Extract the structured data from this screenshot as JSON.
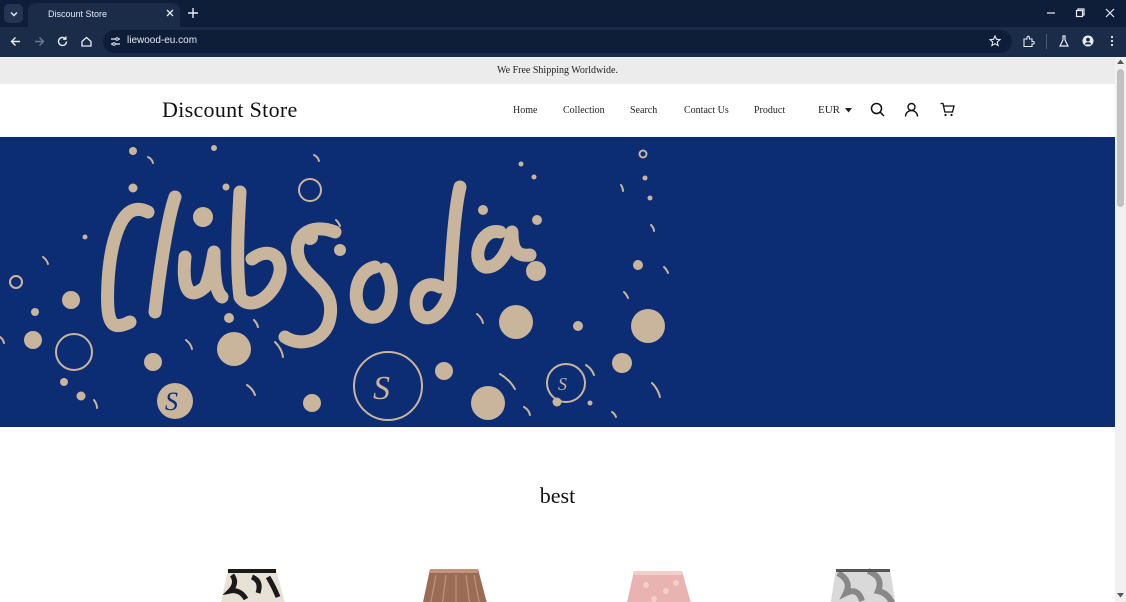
{
  "browser": {
    "tab_title": "Discount Store",
    "url": "liewood-eu.com",
    "icons": [
      "tab-search-icon",
      "close-icon",
      "plus-icon",
      "minimize-icon",
      "restore-icon",
      "close-window-icon",
      "back-icon",
      "forward-icon",
      "reload-icon",
      "home-icon",
      "site-info-icon",
      "star-icon",
      "extensions-icon",
      "labs-icon",
      "profile-icon",
      "more-icon"
    ]
  },
  "announcement": "We Free Shipping Worldwide.",
  "header": {
    "logo": "Discount Store",
    "nav": [
      "Home",
      "Collection",
      "Search",
      "Contact Us",
      "Product"
    ],
    "currency": "EUR",
    "icons": [
      "search-icon",
      "account-icon",
      "cart-icon"
    ]
  },
  "hero": {
    "alt_text_visible": "Club Soda",
    "background": "#0c2d73",
    "art_color": "#c9b49c"
  },
  "section": {
    "title": "best"
  },
  "products": [
    {
      "colors": [
        "#1a1a1a",
        "#e8e2d6"
      ]
    },
    {
      "colors": [
        "#9a6b55",
        "#c2927a"
      ]
    },
    {
      "colors": [
        "#e8b3b0",
        "#f3cfcc"
      ]
    },
    {
      "colors": [
        "#888888",
        "#d9d9d9"
      ]
    }
  ]
}
